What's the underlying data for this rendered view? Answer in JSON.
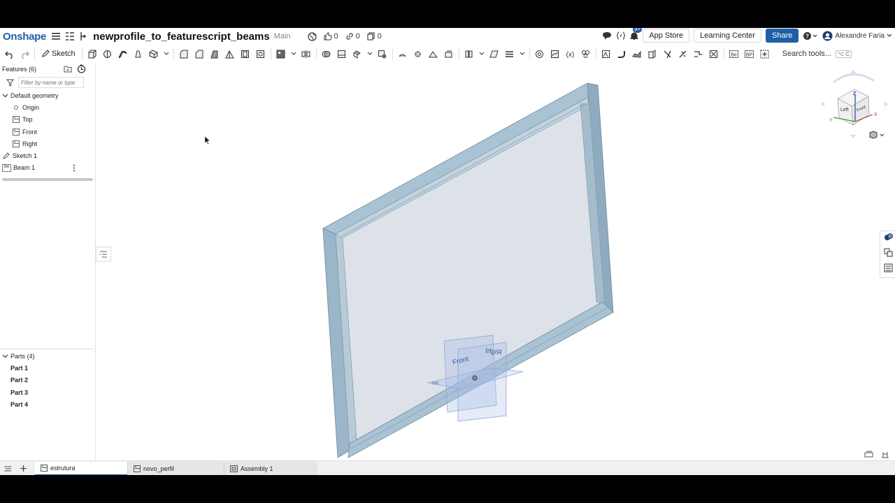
{
  "app": {
    "name": "Onshape"
  },
  "document": {
    "title": "newprofile_to_featurescript_beams",
    "branch": "Main"
  },
  "counters": {
    "likes": "0",
    "links": "0",
    "copies": "0"
  },
  "notifications": {
    "badge": "9+"
  },
  "top_right": {
    "app_store": "App Store",
    "learning_center": "Learning Center",
    "share": "Share",
    "user": "Alexandre Faria"
  },
  "toolbar": {
    "sketch_label": "Sketch",
    "search_label": "Search tools...",
    "search_shortcut": "⌥ C"
  },
  "features": {
    "header": "Features (6)",
    "filter_placeholder": "Filter by name or type",
    "default_geometry": "Default geometry",
    "items": [
      {
        "label": "Origin",
        "icon": "origin-icon"
      },
      {
        "label": "Top",
        "icon": "plane-icon"
      },
      {
        "label": "Front",
        "icon": "plane-icon"
      },
      {
        "label": "Right",
        "icon": "plane-icon"
      }
    ],
    "sketch": "Sketch 1",
    "beam_icon_text": "Be",
    "beam": "Beam 1"
  },
  "parts": {
    "header": "Parts (4)",
    "items": [
      "Part 1",
      "Part 2",
      "Part 3",
      "Part 4"
    ]
  },
  "view_cube": {
    "top": "Z",
    "left": "Left",
    "front": "Front",
    "axis_x": "X",
    "axis_y": "Y"
  },
  "viewport_planes": {
    "front": "Front",
    "right": "Right",
    "top": "Top"
  },
  "tabs": [
    {
      "label": "estrutura",
      "active": true
    },
    {
      "label": "novo_perfil",
      "active": false
    },
    {
      "label": "Assembly 1",
      "active": false
    }
  ],
  "colors": {
    "brand": "#1f5fa8",
    "beam": "#a9c3d4",
    "panel": "#dde1e8",
    "plane": "#8aa8d8"
  }
}
